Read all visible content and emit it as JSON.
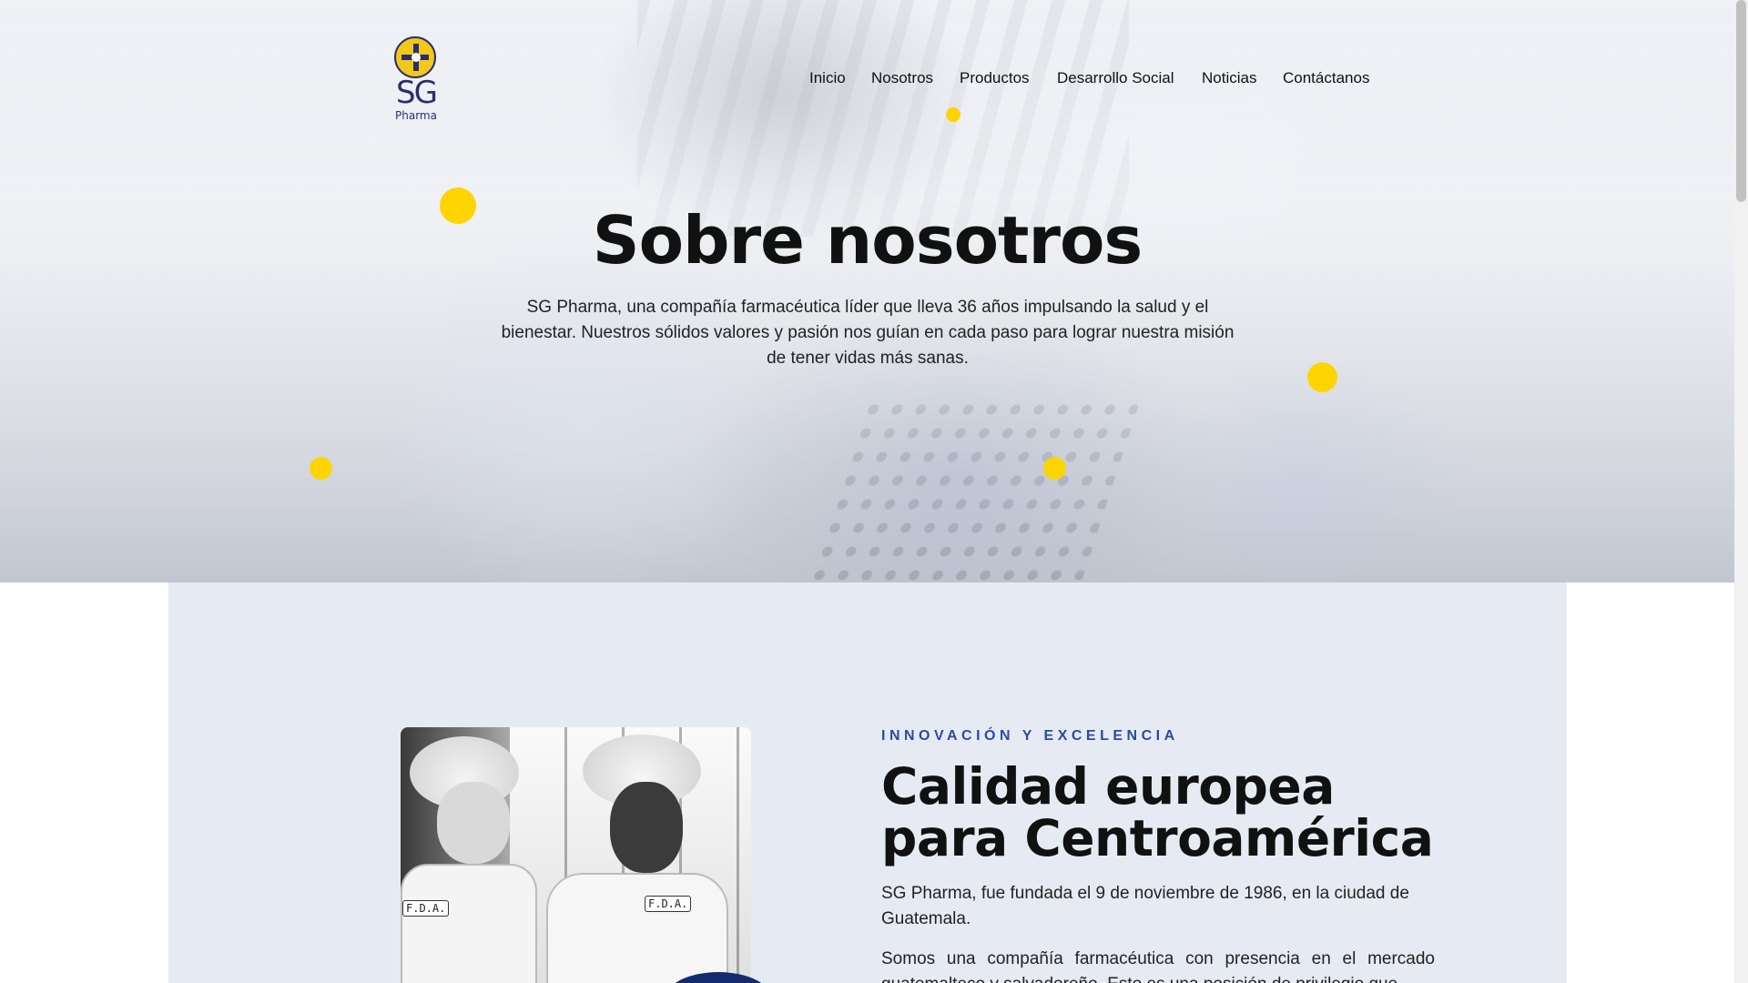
{
  "brand": {
    "logo_text": "SG",
    "logo_subtext": "Pharma",
    "accent_yellow": "#ffd400",
    "brand_navy": "#2a2f6b",
    "eyebrow_blue": "#2b4aa3",
    "section_bg": "#e6ebf3"
  },
  "nav": {
    "items": [
      {
        "label": "Inicio"
      },
      {
        "label": "Nosotros"
      },
      {
        "label": "Productos"
      },
      {
        "label": "Desarrollo Social"
      },
      {
        "label": "Noticias"
      },
      {
        "label": "Contáctanos"
      }
    ],
    "active": "Nosotros"
  },
  "hero": {
    "title": "Sobre nosotros",
    "text": "SG Pharma, una compañía farmacéutica líder que lleva 36 años impulsando la salud y el bienestar. Nuestros sólidos valores y pasión nos guían en cada paso para lograr nuestra misión de tener vidas más sanas."
  },
  "about": {
    "eyebrow": "INNOVACIÓN Y EXCELENCIA",
    "title_line1": "Calidad europea",
    "title_line2": "para Centroamérica",
    "paragraph1": "SG Pharma, fue fundada el 9 de noviembre de 1986, en la ciudad de Guatemala.",
    "paragraph2": "Somos una compañía farmacéutica con presencia en el mercado guatemalteco y salvadoreño. Esto es una posición de privilegio que",
    "photo_badge_left": "F.D.A.",
    "photo_badge_right": "F.D.A."
  },
  "icons": {
    "logo": "sg-pharma-cross-icon",
    "decor": "yellow-dot-icon",
    "scroll": "scrollbar-thumb"
  }
}
